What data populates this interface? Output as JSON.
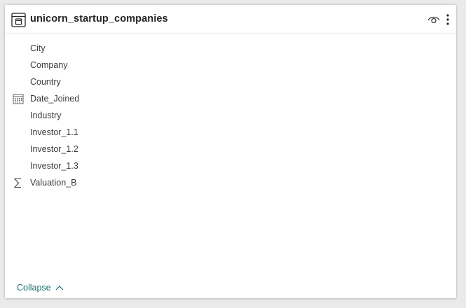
{
  "header": {
    "title": "unicorn_startup_companies",
    "table_icon": "table-icon",
    "visibility_icon": "eye-icon",
    "menu_icon": "more-vertical-icon"
  },
  "fields": [
    {
      "label": "City",
      "icon": ""
    },
    {
      "label": "Company",
      "icon": ""
    },
    {
      "label": "Country",
      "icon": ""
    },
    {
      "label": "Date_Joined",
      "icon": "calendar-icon"
    },
    {
      "label": "Industry",
      "icon": ""
    },
    {
      "label": "Investor_1.1",
      "icon": ""
    },
    {
      "label": "Investor_1.2",
      "icon": ""
    },
    {
      "label": "Investor_1.3",
      "icon": ""
    },
    {
      "label": "Valuation_B",
      "icon": "sigma-icon"
    }
  ],
  "footer": {
    "collapse_label": "Collapse",
    "collapse_icon": "chevron-up-icon"
  },
  "colors": {
    "accent": "#1d6f70",
    "text": "#3b3a39",
    "title": "#252423",
    "background": "#eaeaea",
    "card": "#ffffff"
  }
}
